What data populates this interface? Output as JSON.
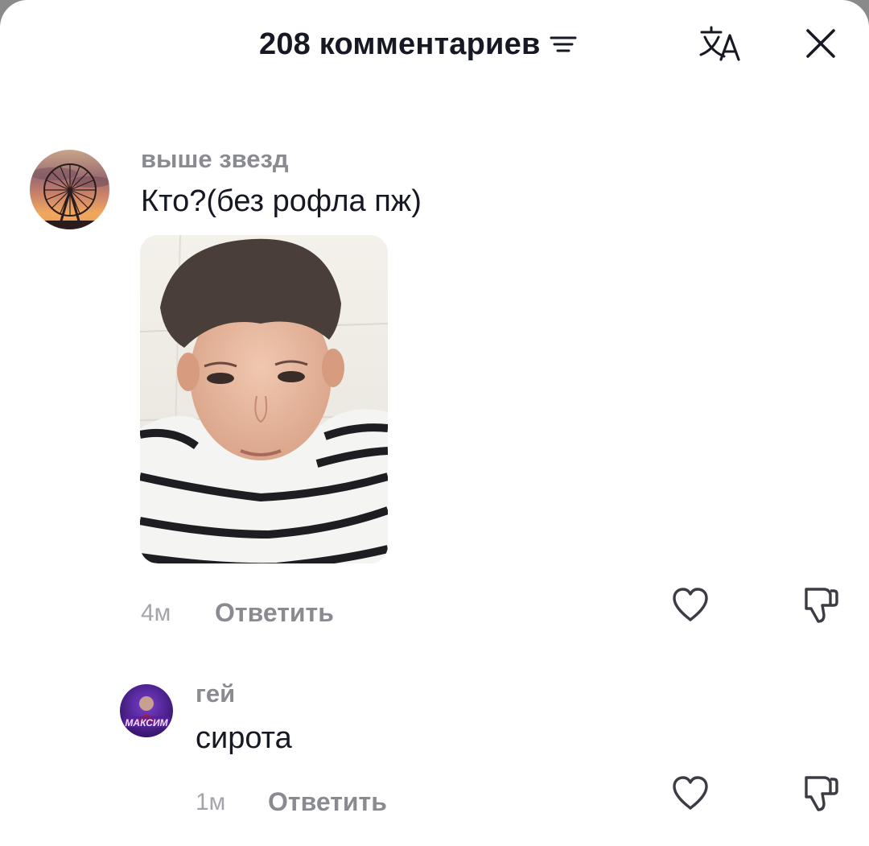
{
  "header": {
    "title": "208 комментариев",
    "sort_icon": "sort-lines-icon",
    "translate_icon": "translate-icon",
    "close_icon": "close-icon"
  },
  "comments": [
    {
      "username": "выше звезд",
      "text": "Кто?(без рофла пж)",
      "avatar": "ferris-wheel-sunset-avatar",
      "attachment": "photo-boy-striped-shirt",
      "time": "4м",
      "reply_label": "Ответить",
      "like_icon": "heart-icon",
      "dislike_icon": "thumbs-down-icon",
      "replies": [
        {
          "username": "гей",
          "text": "сирота",
          "avatar": "purple-gaming-avatar",
          "avatar_text": "МАКСИМ",
          "time": "1м",
          "reply_label": "Ответить",
          "like_icon": "heart-icon",
          "dislike_icon": "thumbs-down-icon"
        }
      ]
    }
  ],
  "colors": {
    "text_primary": "#161823",
    "text_secondary": "#8a8b91",
    "text_tertiary": "#a4a5aa",
    "background": "#ffffff"
  }
}
